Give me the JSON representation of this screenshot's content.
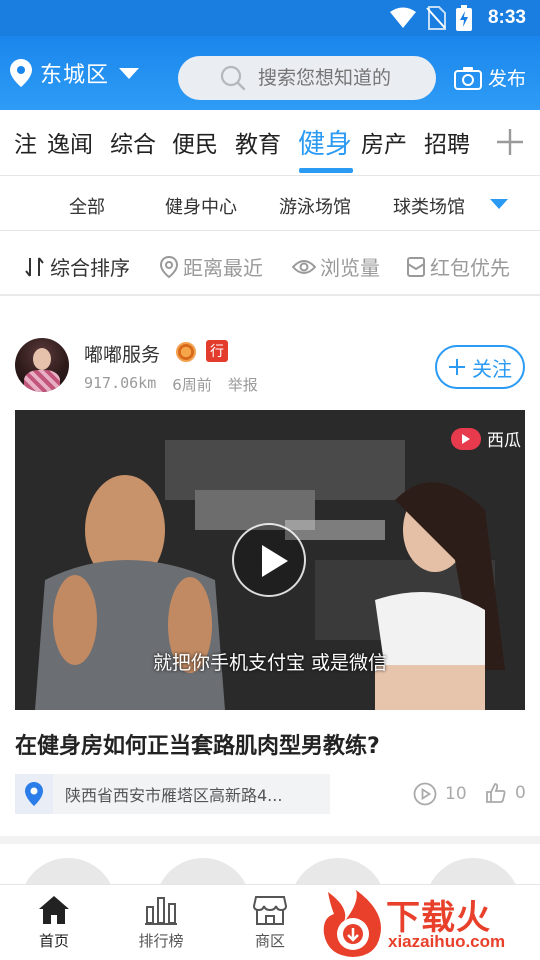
{
  "status_bar": {
    "time": "8:33"
  },
  "header": {
    "location": "东城区",
    "search_placeholder": "搜索您想知道的",
    "publish_label": "发布"
  },
  "tabs": [
    {
      "label": "注",
      "active": false
    },
    {
      "label": "逸闻",
      "active": false
    },
    {
      "label": "综合",
      "active": false
    },
    {
      "label": "便民",
      "active": false
    },
    {
      "label": "教育",
      "active": false
    },
    {
      "label": "健身",
      "active": true
    },
    {
      "label": "房产",
      "active": false
    },
    {
      "label": "招聘",
      "active": false
    }
  ],
  "subtabs": [
    "全部",
    "健身中心",
    "游泳场馆",
    "球类场馆"
  ],
  "sort_options": [
    {
      "label": "综合排序",
      "icon": "sort-icon",
      "active": true
    },
    {
      "label": "距离最近",
      "icon": "location-pin-icon",
      "active": false
    },
    {
      "label": "浏览量",
      "icon": "eye-icon",
      "active": false
    },
    {
      "label": "红包优先",
      "icon": "red-envelope-icon",
      "active": false
    }
  ],
  "post": {
    "author": "嘟嘟服务",
    "badge": "行",
    "distance": "917.06km",
    "time": "6周前",
    "report_label": "举报",
    "follow_label": "关注",
    "video_subtitle": "就把你手机支付宝 或是微信",
    "video_watermark": "西瓜",
    "title": "在健身房如何正当套路肌肉型男教练?",
    "address": "陕西省西安市雁塔区高新路4...",
    "plays": "10",
    "likes": "0"
  },
  "bottom_nav": [
    {
      "label": "首页",
      "icon": "home-icon",
      "active": true
    },
    {
      "label": "排行榜",
      "icon": "bar-chart-icon",
      "active": false
    },
    {
      "label": "商区",
      "icon": "store-icon",
      "active": false
    }
  ],
  "logo": {
    "main": "下载火",
    "sub": "xiazaihuo.com"
  },
  "colors": {
    "accent": "#2b9af3",
    "header": "#1a86ec",
    "logo": "#e8402b"
  }
}
